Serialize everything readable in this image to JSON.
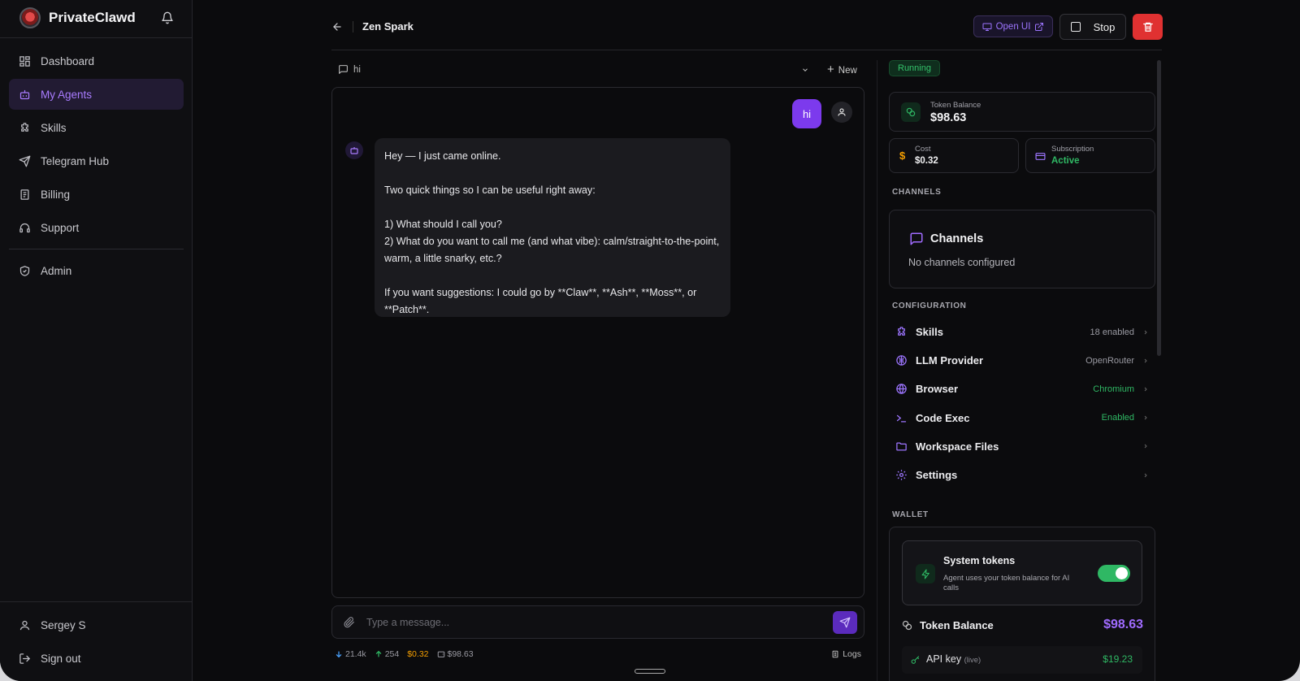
{
  "app": {
    "name": "PrivateClawd"
  },
  "sidebar": {
    "items": [
      {
        "label": "Dashboard",
        "icon": "dashboard-icon",
        "active": false
      },
      {
        "label": "My Agents",
        "icon": "bot-icon",
        "active": true
      },
      {
        "label": "Skills",
        "icon": "puzzle-icon",
        "active": false
      },
      {
        "label": "Telegram Hub",
        "icon": "send-icon",
        "active": false
      },
      {
        "label": "Billing",
        "icon": "receipt-icon",
        "active": false
      },
      {
        "label": "Support",
        "icon": "headset-icon",
        "active": false
      }
    ],
    "admin": "Admin",
    "user_name": "Sergey S",
    "sign_out": "Sign out"
  },
  "header": {
    "agent_name": "Zen Spark",
    "open_ui_label": "Open UI",
    "stop_label": "Stop"
  },
  "chat": {
    "thread_title": "hi",
    "new_label": "New",
    "user_message": "hi",
    "bot_message": [
      "Hey — I just came online.",
      "Two quick things so I can be useful right away:",
      "1) What should I call you?",
      "2) What do you want to call me (and what vibe): calm/straight-to-the-point, warm, a little snarky, etc.?",
      "If you want suggestions: I could go by **Claw**, **Ash**, **Moss**, or **Patch**."
    ],
    "input_placeholder": "Type a message...",
    "stats": {
      "tokens_in": "21.4k",
      "tokens_out": "254",
      "cost": "$0.32",
      "balance": "$98.63",
      "logs_label": "Logs"
    }
  },
  "panel": {
    "status": "Running",
    "token_balance_label": "Token Balance",
    "token_balance_value": "$98.63",
    "cost_label": "Cost",
    "cost_value": "$0.32",
    "subscription_label": "Subscription",
    "subscription_value": "Active",
    "channels_section": "CHANNELS",
    "channels_title": "Channels",
    "channels_empty": "No channels configured",
    "configuration_section": "CONFIGURATION",
    "config": [
      {
        "label": "Skills",
        "value": "18 enabled",
        "icon": "puzzle-icon"
      },
      {
        "label": "LLM Provider",
        "value": "OpenRouter",
        "icon": "brain-icon"
      },
      {
        "label": "Browser",
        "value": "Chromium",
        "icon": "globe-icon"
      },
      {
        "label": "Code Exec",
        "value": "Enabled",
        "icon": "terminal-icon"
      },
      {
        "label": "Workspace Files",
        "value": "",
        "icon": "folder-icon"
      },
      {
        "label": "Settings",
        "value": "",
        "icon": "gear-icon"
      }
    ],
    "wallet_section": "WALLET",
    "system_tokens_title": "System tokens",
    "system_tokens_desc": "Agent uses your token balance for AI calls",
    "system_tokens_enabled": true,
    "wallet_balance_label": "Token Balance",
    "wallet_balance_value": "$98.63",
    "api_key_label": "API key",
    "api_key_tag": "(live)",
    "api_key_value": "$19.23"
  },
  "colors": {
    "accent": "#7c3aed",
    "green": "#2fb864",
    "danger": "#e03131",
    "cost": "#f59f00"
  }
}
